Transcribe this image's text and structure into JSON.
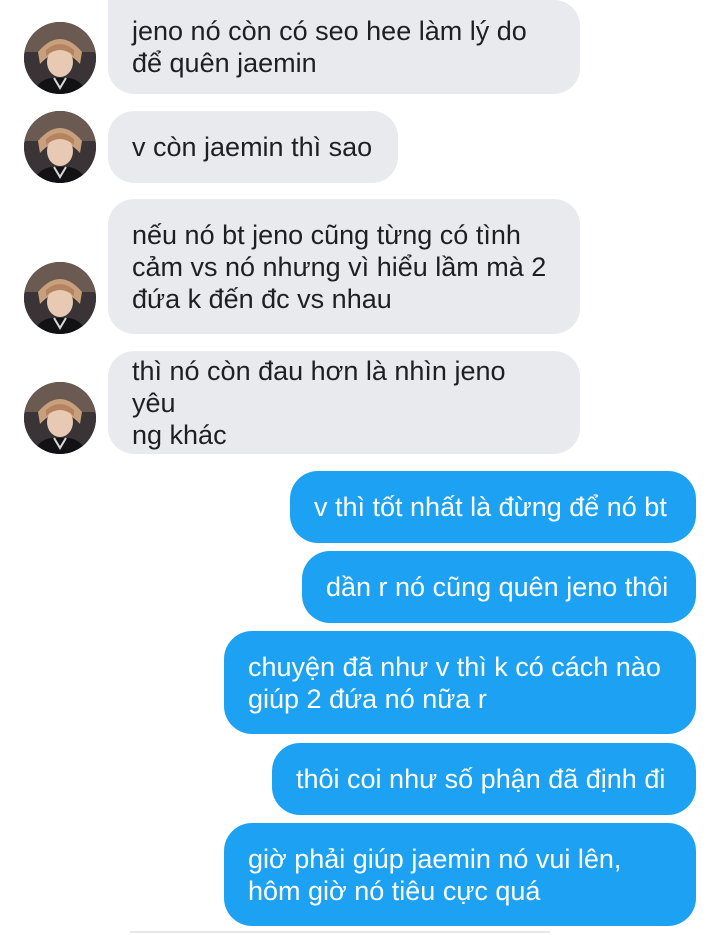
{
  "conversation": {
    "incoming": [
      {
        "text": "jeno nó còn có seo hee làm lý do\nđể quên jaemin"
      },
      {
        "text": "v còn jaemin thì sao"
      },
      {
        "text": "nếu nó bt jeno cũng từng có tình\ncảm vs nó nhưng vì hiểu lầm mà 2\nđứa k đến đc vs nhau"
      },
      {
        "text": "thì nó còn đau hơn là nhìn jeno yêu\nng khác"
      }
    ],
    "outgoing": [
      {
        "text": "v thì tốt nhất là đừng để nó bt"
      },
      {
        "text": "dần r nó cũng quên jeno thôi"
      },
      {
        "text": "chuyện đã như v thì k có cách nào\ngiúp 2 đứa nó nữa r"
      },
      {
        "text": "thôi coi như số phận đã định đi"
      },
      {
        "text": "giờ phải giúp jaemin nó vui lên,\nhôm giờ nó tiêu cực quá"
      }
    ]
  },
  "colors": {
    "incoming_bubble": "#e9eaee",
    "outgoing_bubble": "#1da1f2",
    "incoming_text": "#1d1f23",
    "outgoing_text": "#ffffff"
  },
  "icons": {
    "avatar": "contact-avatar-photo"
  }
}
